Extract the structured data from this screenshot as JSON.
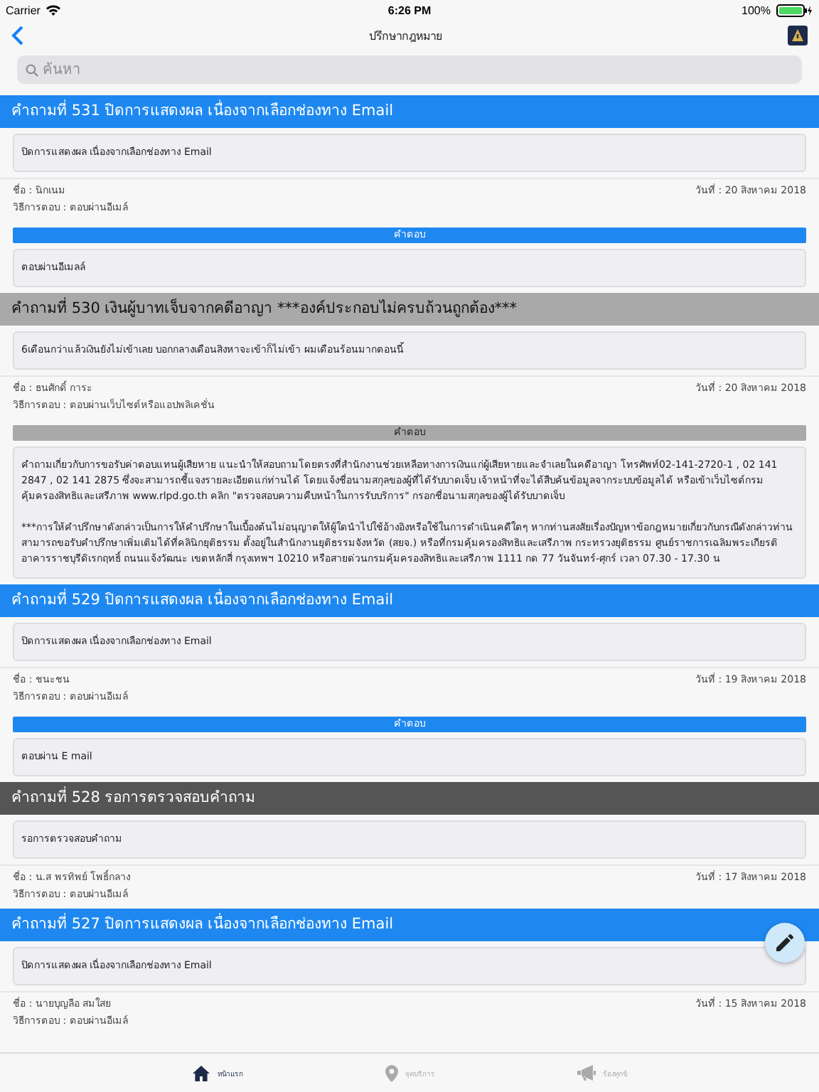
{
  "status_bar": {
    "carrier": "Carrier",
    "time": "6:26 PM",
    "battery": "100%"
  },
  "nav": {
    "title": "ปรึกษากฎหมาย"
  },
  "search": {
    "placeholder": "ค้นหา"
  },
  "questions": [
    {
      "kind": "answered",
      "title": "คำถามที่ 531 ปิดการแสดงผล เนื่องจากเลือกช่องทาง Email",
      "body": "ปิดการแสดงผล เนื่องจากเลือกช่องทาง Email",
      "name": "ชื่อ : นิกเนม",
      "date": "วันที่ : 20 สิงหาคม 2018",
      "method": "วิธีการตอบ : ตอบผ่านอีเมล์",
      "answer_label": "คำตอบ",
      "answer": [
        "ตอบผ่านอีเมลล์"
      ]
    },
    {
      "kind": "incomplete",
      "title": "คำถามที่ 530 เงินผู้บาทเจ็บจากคดีอาญา ***องค์ประกอบไม่ครบถ้วนถูกต้อง***",
      "body": "6เดือนกว่าแล้วเงินยังไม่เข้าเลย  บอกกลางเดือนสิงหาจะเข้าก็ไม่เข้า  ผมเดือนร้อนมากตอนนี้",
      "name": "ชื่อ : ธนศักดิ์ การะ",
      "date": "วันที่ : 20 สิงหาคม 2018",
      "method": "วิธีการตอบ : ตอบผ่านเว็บไซต์หรือแอปพลิเคชั่น",
      "answer_label": "คำตอบ",
      "answer": [
        "คำถามเกี่ยวกับการขอรับค่าตอบแทนผู้เสียหาย แนะนำให้สอบถามโดยตรงที่สำนักงานช่วยเหลือทางการเงินแก่ผู้เสียหายและจำเลยในคดีอาญา โทรศัพท์02-141-2720-1 , 02 141 2847 , 02 141 2875 ซึ่งจะสามารถชี้แจงรายละเอียดแก่ท่านได้ โดยแจ้งชื่อนามสกุลของผู้ที่ได้รับบาดเจ็บ เจ้าหน้าที่จะได้สืบค้นข้อมูลจากระบบข้อมูลได้ หรือเข้าเว็บไซต์กรมคุ้มครองสิทธิและเสรีภาพ www.rlpd.go.th คลิก \"ตรวจสอบความคืบหน้าในการรับบริการ\" กรอกชื่อนามสกุลของผู้ได้รับบาดเจ็บ",
        "***การให้คำปรึกษาดังกล่าวเป็นการให้คำปรึกษาในเบื้องต้นไม่อนุญาตให้ผู้ใดนำไปใช้อ้างอิงหรือใช้ในการดำเนินคดีใดๆ หากท่านสงสัยเรื่องปัญหาข้อกฎหมายเกี่ยวกับกรณีดังกล่าวท่านสามารถขอรับคำปรึกษาเพิ่มเติมได้ที่คลินิกยุติธรรม ตั้งอยู่ในสำนักงานยุติธรรมจังหวัด (สยจ.) หรือที่กรมคุ้มครองสิทธิและเสรีภาพ กระทรวงยุติธรรม ศูนย์ราชการเฉลิมพระเกียรติ อาคารราชบุรีดิเรกฤทธิ์ ถนนแจ้งวัฒนะ เขตหลักสี่ กรุงเทพฯ 10210 หรือสายด่วนกรมคุ้มครองสิทธิและเสรีภาพ 1111 กด 77 วันจันทร์-ศุกร์ เวลา 07.30 - 17.30 น"
      ]
    },
    {
      "kind": "answered",
      "title": "คำถามที่ 529 ปิดการแสดงผล เนื่องจากเลือกช่องทาง Email",
      "body": "ปิดการแสดงผล เนื่องจากเลือกช่องทาง Email",
      "name": "ชื่อ : ชนะชน",
      "date": "วันที่ : 19 สิงหาคม 2018",
      "method": "วิธีการตอบ : ตอบผ่านอีเมล์",
      "answer_label": "คำตอบ",
      "answer": [
        "ตอบผ่าน E mail"
      ]
    },
    {
      "kind": "pending",
      "title": "คำถามที่ 528 รอการตรวจสอบคำถาม",
      "body": "รอการตรวจสอบคำถาม",
      "name": "ชื่อ : น.ส พรทิพย์ โพธิ์กลาง",
      "date": "วันที่ : 17 สิงหาคม 2018",
      "method": "วิธีการตอบ : ตอบผ่านอีเมล์"
    },
    {
      "kind": "answered",
      "title": "คำถามที่ 527 ปิดการแสดงผล เนื่องจากเลือกช่องทาง Email",
      "body": "ปิดการแสดงผล เนื่องจากเลือกช่องทาง Email",
      "name": "ชื่อ : นายบุญลือ สมใสย",
      "date": "วันที่ : 15 สิงหาคม 2018",
      "method": "วิธีการตอบ : ตอบผ่านอีเมล์"
    }
  ],
  "tabs": [
    {
      "label": "หน้าแรก",
      "selected": true
    },
    {
      "label": "จุดบริการ",
      "selected": false
    },
    {
      "label": "ร้องทุกข์",
      "selected": false
    }
  ]
}
